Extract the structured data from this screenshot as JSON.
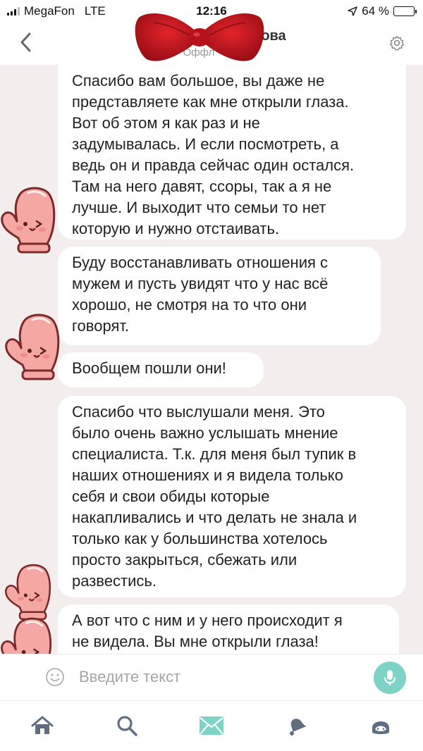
{
  "status_bar": {
    "carrier": "MegaFon",
    "network": "LTE",
    "time": "12:16",
    "battery_percent": "64 %",
    "battery_level": 0.64
  },
  "header": {
    "title": "ова",
    "subtitle": "Оффл",
    "back_icon": "chevron-left-icon",
    "settings_icon": "gear-icon",
    "sticker": "red-bow-sticker"
  },
  "messages": [
    {
      "lines": [
        "Спасибо вам большое, вы даже не",
        "представляете как мне открыли глаза.",
        "Вот об этом я как раз и не",
        "задумывалась. И если посмотреть, а",
        "ведь он и правда сейчас один остался.",
        "Там на него давят, ссоры, так а я не",
        "лучше. И выходит что семьи то нет",
        "которую и нужно отстаивать."
      ]
    },
    {
      "lines": [
        "Буду восстанавливать отношения с",
        "мужем и пусть увидят что у нас всё",
        "хорошо, не смотря на то что они",
        "говорят."
      ]
    },
    {
      "lines": [
        "Вообщем пошли они!"
      ]
    },
    {
      "lines": [
        "Спасибо что выслушали меня. Это",
        "было очень важно услышать мнение",
        "специалиста. Т.к. для меня был тупик в",
        "наших отношениях и я видела только",
        "себя и свои обиды которые",
        "накапливались и что делать не знала и",
        "только как у большинства хотелось",
        "просто закрыться, сбежать или",
        "развестись."
      ]
    },
    {
      "lines": [
        "А вот что с ним и у него происходит я",
        "не видела. Вы мне открыли глаза!"
      ]
    }
  ],
  "avatar_icon": "pink-mitten-avatar-icon",
  "composer": {
    "placeholder": "Введите текст",
    "emoji_icon": "smile-icon",
    "mic_icon": "microphone-icon"
  },
  "tabs": [
    {
      "name": "home",
      "icon": "home-icon"
    },
    {
      "name": "search",
      "icon": "search-icon"
    },
    {
      "name": "messages",
      "icon": "envelope-icon",
      "active": true
    },
    {
      "name": "notifications",
      "icon": "bell-icon"
    },
    {
      "name": "profile",
      "icon": "profile-icon"
    }
  ],
  "colors": {
    "accent": "#7dd3c6",
    "chat_background": "#f3eded",
    "bubble": "#ffffff",
    "inactive_icon": "#5f6f80",
    "mitten": "#f4a7a3"
  }
}
